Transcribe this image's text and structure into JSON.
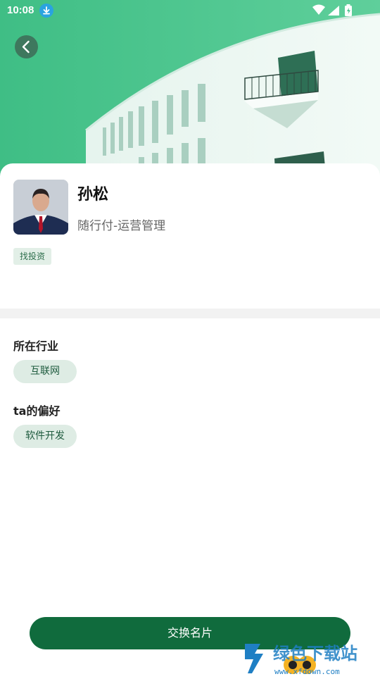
{
  "status_bar": {
    "time": "10:08"
  },
  "profile": {
    "name": "孙松",
    "company_title": "随行付-运营管理",
    "tag": "找投资"
  },
  "industry": {
    "title": "所在行业",
    "value": "互联网"
  },
  "preference": {
    "title": "ta的偏好",
    "value": "软件开发"
  },
  "action": {
    "exchange_label": "交换名片"
  },
  "watermark": {
    "brand": "绿色下载站",
    "domain": "www.xfdown.com"
  },
  "colors": {
    "accent": "#106b3d",
    "hero": "#3dbf86",
    "pill_bg": "#deece4"
  }
}
